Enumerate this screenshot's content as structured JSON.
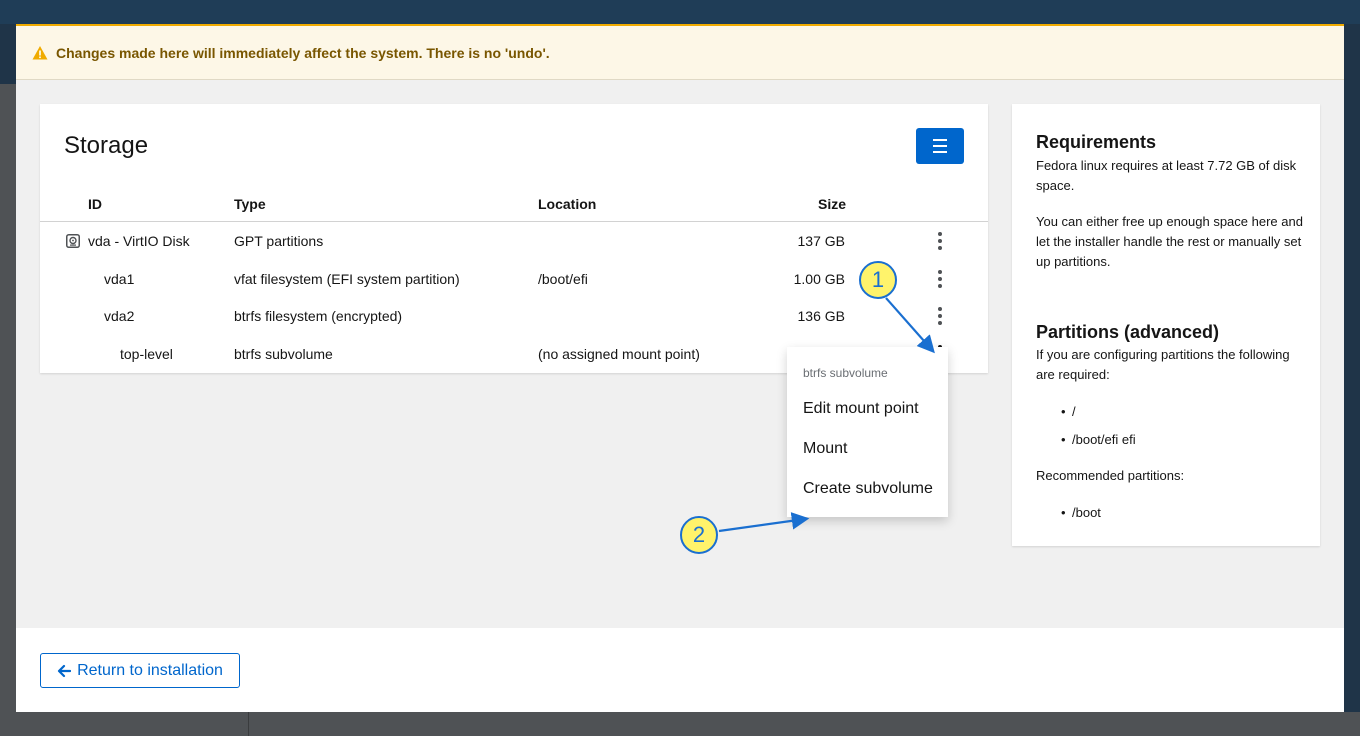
{
  "alert": {
    "text": "Changes made here will immediately affect the system. There is no 'undo'."
  },
  "storage": {
    "title": "Storage",
    "columns": {
      "id": "ID",
      "type": "Type",
      "location": "Location",
      "size": "Size"
    },
    "rows": [
      {
        "id": "vda - VirtIO Disk",
        "type": "GPT partitions",
        "location": "",
        "size": "137 GB"
      },
      {
        "id": "vda1",
        "type": "vfat filesystem (EFI system partition)",
        "location": "/boot/efi",
        "size": "1.00 GB"
      },
      {
        "id": "vda2",
        "type": "btrfs filesystem (encrypted)",
        "location": "",
        "size": "136 GB"
      },
      {
        "id": "top-level",
        "type": "btrfs subvolume",
        "location": "(no assigned mount point)",
        "size": ""
      }
    ]
  },
  "dropdown": {
    "group": "btrfs subvolume",
    "items": [
      "Edit mount point",
      "Mount",
      "Create subvolume"
    ]
  },
  "sidebar": {
    "requirements_title": "Requirements",
    "requirements_text": "Fedora linux requires at least 7.72 GB of disk space.",
    "requirements_text2": "You can either free up enough space here and let the installer handle the rest or manually set up partitions.",
    "partitions_title": "Partitions (advanced)",
    "partitions_text": "If you are configuring partitions the following are required:",
    "required": [
      "/",
      "/boot/efi efi"
    ],
    "recommended_label": "Recommended partitions:",
    "recommended": [
      "/boot"
    ]
  },
  "footer": {
    "return_label": "Return to installation"
  },
  "callouts": [
    "1",
    "2"
  ],
  "colors": {
    "primary": "#0066cc",
    "warning": "#f0ab00",
    "callout_fill": "#fff36b",
    "callout_stroke": "#1a6fd0"
  }
}
